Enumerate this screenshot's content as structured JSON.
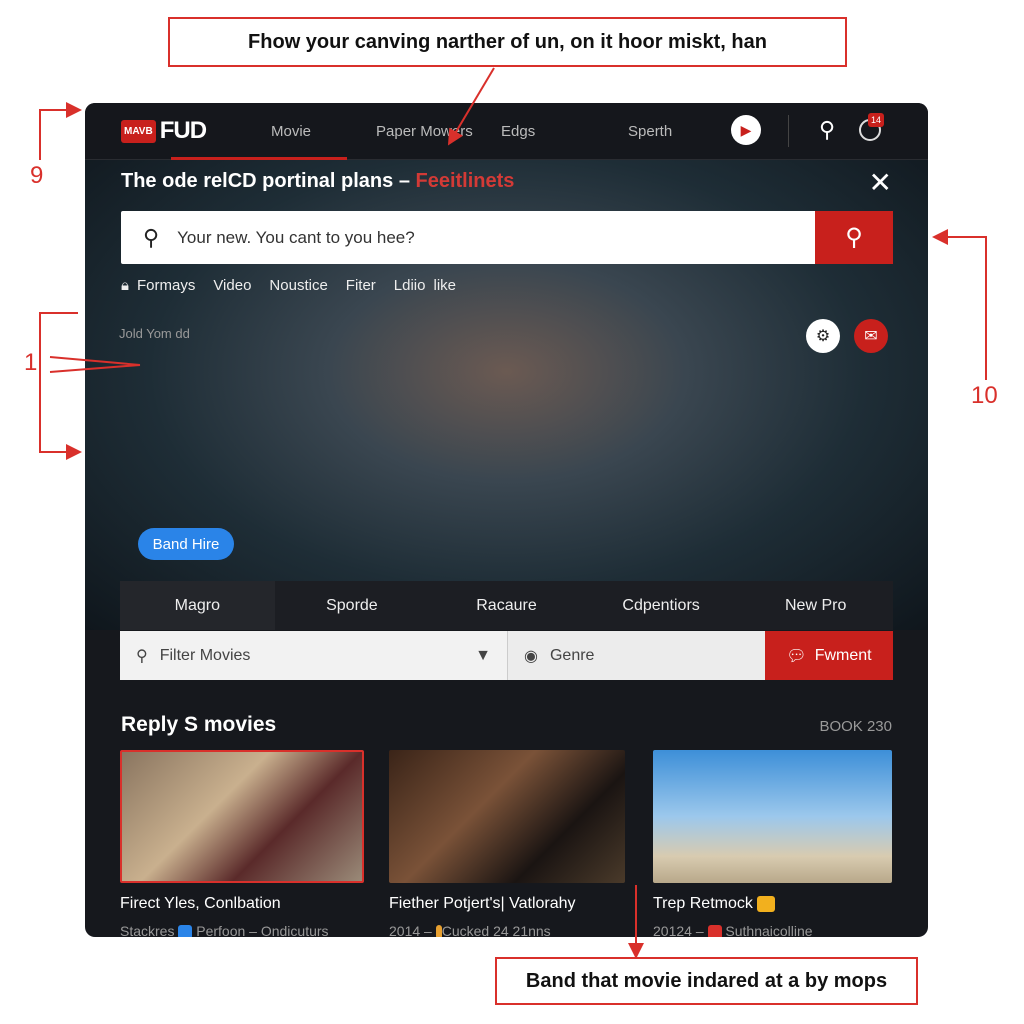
{
  "annotations": {
    "top": "Fhow your canving narther of un, on it hoor miskt, han",
    "bottom": "Band that movie indared at a by mops",
    "num_left_top": "9",
    "num_left_mid": "1",
    "num_right": "10"
  },
  "nav": {
    "logo_badge": "MAVB",
    "logo_text": "FUD",
    "items": [
      "Movie",
      "Paper Mowers",
      "Edgs",
      "Sperth"
    ],
    "notification_count": "14"
  },
  "hero": {
    "title": "The ode relCD portinal plans –",
    "title_accent": "Feeitlinets",
    "close": "✕",
    "search_placeholder": "Your new. You cant to you hee?",
    "chips": [
      "Formays",
      "Video",
      "Noustice",
      "Fiter",
      "Ldiio",
      "like"
    ],
    "caption": "Jold Yom dd",
    "button": "Band Hire"
  },
  "tabs": [
    "Magro",
    "Sporde",
    "Racaure",
    "Cdpentiors",
    "New Pro"
  ],
  "filter": {
    "movies_placeholder": "Filter Movies",
    "genre": "Genre",
    "action": "Fwment"
  },
  "section": {
    "title": "Reply S movies",
    "count": "BOOK 230"
  },
  "cards": [
    {
      "title": "Firect Yles, Conlbation",
      "meta_a": "Stackres",
      "meta_b": "Perfoon – Ondicuturs"
    },
    {
      "title": "Fiether Potjert's| Vatlorahy",
      "meta_a": "2014 –",
      "meta_b": "Cucked 24  21nns"
    },
    {
      "title": "Trep Retmock",
      "meta_a": "20124 –",
      "meta_b": "Suthnaicolline"
    }
  ],
  "colors": {
    "accent": "#c8201c",
    "link_blue": "#2a84e8",
    "background": "#16181d"
  }
}
